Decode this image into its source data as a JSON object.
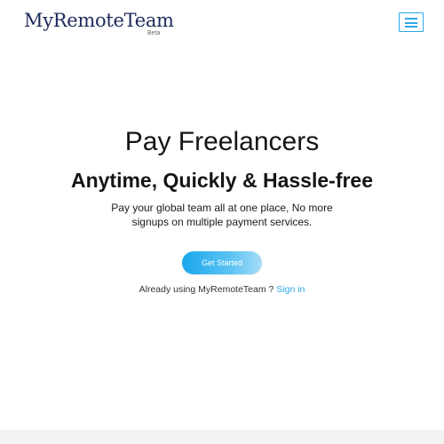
{
  "brand": {
    "name": "MyRemoteTeam",
    "badge": "Beta",
    "color": "#1d2a5b"
  },
  "header": {
    "menu_icon": "hamburger-menu-icon",
    "accent": "#2ea8e6"
  },
  "hero": {
    "title": "Pay Freelancers",
    "subtitle": "Anytime, Quickly & Hassle-free",
    "description": "Pay your global team all at one place, No more signups on multiple payment services."
  },
  "cta": {
    "label": "Get Started"
  },
  "signin": {
    "prompt": "Already using MyRemoteTeam ? ",
    "link_label": "Sign in"
  }
}
